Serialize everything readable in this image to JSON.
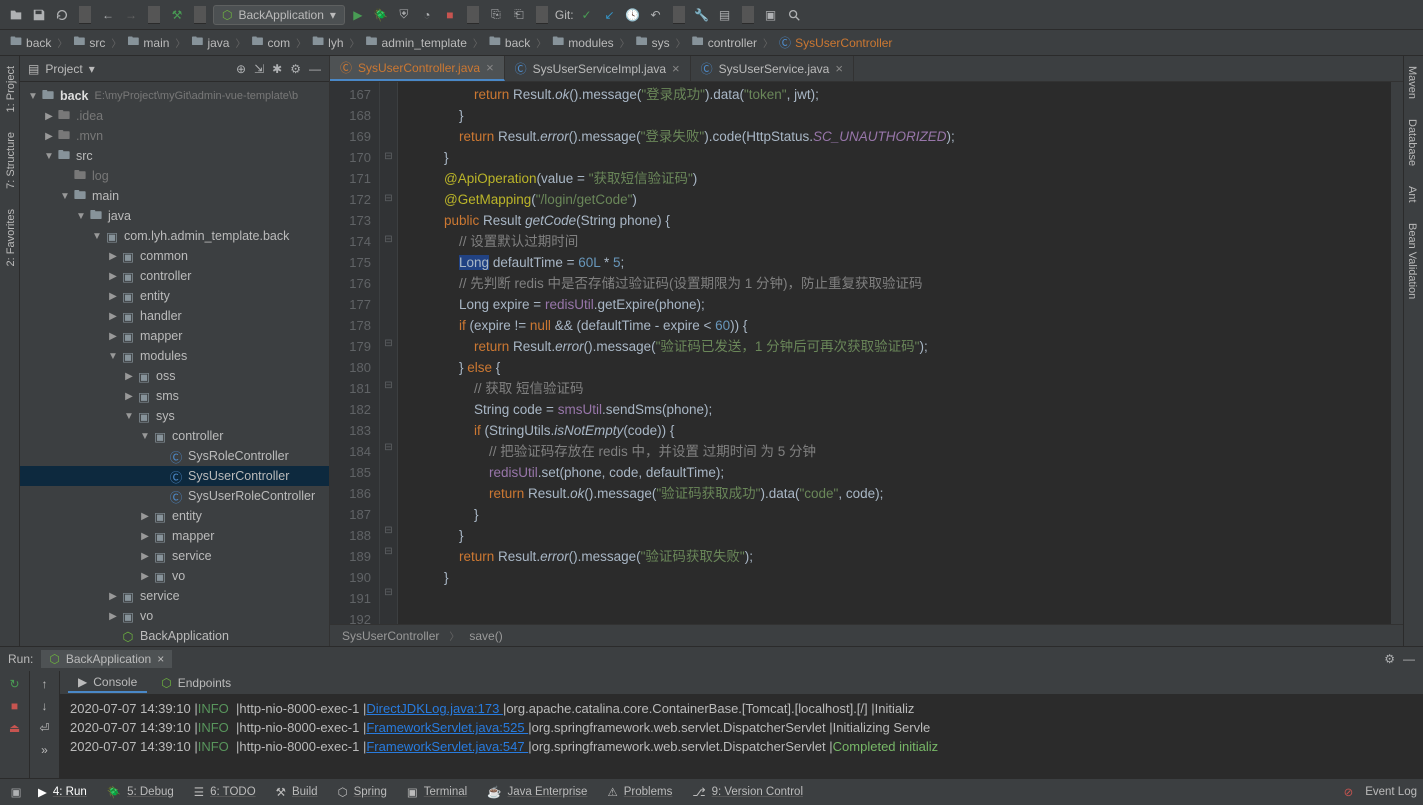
{
  "toolbar": {
    "run_config": "BackApplication",
    "git_label": "Git:"
  },
  "breadcrumbs": [
    "back",
    "src",
    "main",
    "java",
    "com",
    "lyh",
    "admin_template",
    "back",
    "modules",
    "sys",
    "controller",
    "SysUserController"
  ],
  "project": {
    "title": "Project",
    "tree": [
      {
        "depth": 0,
        "arrow": "▼",
        "icon": "folder",
        "label": "back",
        "ext": "E:\\myProject\\myGit\\admin-vue-template\\b",
        "bold": true
      },
      {
        "depth": 1,
        "arrow": "▶",
        "icon": "folder",
        "label": ".idea",
        "dim": true
      },
      {
        "depth": 1,
        "arrow": "▶",
        "icon": "folder",
        "label": ".mvn",
        "dim": true
      },
      {
        "depth": 1,
        "arrow": "▼",
        "icon": "folder",
        "label": "src"
      },
      {
        "depth": 2,
        "arrow": "",
        "icon": "folder",
        "label": "log",
        "dim": true
      },
      {
        "depth": 2,
        "arrow": "▼",
        "icon": "folder",
        "label": "main"
      },
      {
        "depth": 3,
        "arrow": "▼",
        "icon": "folder",
        "label": "java"
      },
      {
        "depth": 4,
        "arrow": "▼",
        "icon": "package",
        "label": "com.lyh.admin_template.back"
      },
      {
        "depth": 5,
        "arrow": "▶",
        "icon": "package",
        "label": "common"
      },
      {
        "depth": 5,
        "arrow": "▶",
        "icon": "package",
        "label": "controller"
      },
      {
        "depth": 5,
        "arrow": "▶",
        "icon": "package",
        "label": "entity"
      },
      {
        "depth": 5,
        "arrow": "▶",
        "icon": "package",
        "label": "handler"
      },
      {
        "depth": 5,
        "arrow": "▶",
        "icon": "package",
        "label": "mapper"
      },
      {
        "depth": 5,
        "arrow": "▼",
        "icon": "package",
        "label": "modules"
      },
      {
        "depth": 6,
        "arrow": "▶",
        "icon": "package",
        "label": "oss"
      },
      {
        "depth": 6,
        "arrow": "▶",
        "icon": "package",
        "label": "sms"
      },
      {
        "depth": 6,
        "arrow": "▼",
        "icon": "package",
        "label": "sys"
      },
      {
        "depth": 7,
        "arrow": "▼",
        "icon": "package",
        "label": "controller"
      },
      {
        "depth": 8,
        "arrow": "",
        "icon": "class",
        "label": "SysRoleController"
      },
      {
        "depth": 8,
        "arrow": "",
        "icon": "class",
        "label": "SysUserController",
        "selected": true
      },
      {
        "depth": 8,
        "arrow": "",
        "icon": "class",
        "label": "SysUserRoleController"
      },
      {
        "depth": 7,
        "arrow": "▶",
        "icon": "package",
        "label": "entity"
      },
      {
        "depth": 7,
        "arrow": "▶",
        "icon": "package",
        "label": "mapper"
      },
      {
        "depth": 7,
        "arrow": "▶",
        "icon": "package",
        "label": "service"
      },
      {
        "depth": 7,
        "arrow": "▶",
        "icon": "package",
        "label": "vo"
      },
      {
        "depth": 5,
        "arrow": "▶",
        "icon": "package",
        "label": "service"
      },
      {
        "depth": 5,
        "arrow": "▶",
        "icon": "package",
        "label": "vo"
      },
      {
        "depth": 5,
        "arrow": "",
        "icon": "class",
        "label": "BackApplication",
        "spring": true
      }
    ]
  },
  "editor": {
    "tabs": [
      {
        "label": "SysUserController.java",
        "active": true,
        "color": "#cc7832"
      },
      {
        "label": "SysUserServiceImpl.java",
        "active": false,
        "color": "#4e8bca"
      },
      {
        "label": "SysUserService.java",
        "active": false,
        "color": "#4e8bca"
      }
    ],
    "line_start": 167,
    "line_end": 192,
    "breadcrumb": [
      "SysUserController",
      "save()"
    ]
  },
  "side_tabs_left": [
    "1: Project",
    "7: Structure",
    "2: Favorites"
  ],
  "side_tabs_right": [
    "Maven",
    "Database",
    "Ant",
    "Bean Validation"
  ],
  "run": {
    "title": "Run:",
    "config": "BackApplication",
    "inner_tabs": [
      "Console",
      "Endpoints"
    ],
    "logs": [
      {
        "ts": "2020-07-07 14:39:10",
        "level": "INFO",
        "thread": "http-nio-8000-exec-1",
        "src": "DirectJDKLog.java:173",
        "logger": "org.apache.catalina.core.ContainerBase.[Tomcat].[localhost].[/]",
        "msg": "Initializ"
      },
      {
        "ts": "2020-07-07 14:39:10",
        "level": "INFO",
        "thread": "http-nio-8000-exec-1",
        "src": "FrameworkServlet.java:525",
        "logger": "org.springframework.web.servlet.DispatcherServlet",
        "msg": "Initializing Servle"
      },
      {
        "ts": "2020-07-07 14:39:10",
        "level": "INFO",
        "thread": "http-nio-8000-exec-1",
        "src": "FrameworkServlet.java:547",
        "logger": "org.springframework.web.servlet.DispatcherServlet",
        "msg": "Completed initializ",
        "completed": true
      }
    ]
  },
  "status": {
    "items": [
      "4: Run",
      "5: Debug",
      "6: TODO",
      "Build",
      "Spring",
      "Terminal",
      "Java Enterprise",
      "Problems",
      "9: Version Control"
    ],
    "event_log": "Event Log"
  },
  "code_lines": [
    {
      "n": 167,
      "html": "                <span class='kw'>return</span> Result.<span class='mth stat'>ok</span>().message(<span class='str'>\"登录成功\"</span>).data(<span class='str'>\"token\"</span>, jwt);"
    },
    {
      "n": 168,
      "html": "            }"
    },
    {
      "n": 169,
      "html": "            <span class='kw'>return</span> Result.<span class='mth stat'>error</span>().message(<span class='str'>\"登录失败\"</span>).code(HttpStatus.<span class='fld stat'>SC_UNAUTHORIZED</span>);"
    },
    {
      "n": 170,
      "html": "        }"
    },
    {
      "n": 171,
      "html": ""
    },
    {
      "n": 172,
      "html": "        <span class='ann'>@ApiOperation</span>(value = <span class='str'>\"获取短信验证码\"</span>)"
    },
    {
      "n": 173,
      "html": "        <span class='ann'>@GetMapping</span>(<span class='str'>\"/login/getCode\"</span>)"
    },
    {
      "n": 174,
      "html": "        <span class='kw'>public</span> Result <span class='mth'>getCode</span>(String phone) {"
    },
    {
      "n": 175,
      "html": "            <span class='com'>// 设置默认过期时间</span>"
    },
    {
      "n": 176,
      "html": "            <span class='hl'>Long</span> defaultTime = <span class='num'>60L</span> * <span class='num'>5</span>;"
    },
    {
      "n": 177,
      "html": "            <span class='com'>// 先判断 redis 中是否存储过验证码(设置期限为 1 分钟)，防止重复获取验证码</span>"
    },
    {
      "n": 178,
      "html": "            Long expire = <span class='fld'>redisUtil</span>.getExpire(phone);"
    },
    {
      "n": 179,
      "html": "            <span class='kw'>if</span> (expire != <span class='kw'>null</span> && (defaultTime - expire &lt; <span class='num'>60</span>)) {"
    },
    {
      "n": 180,
      "html": "                <span class='kw'>return</span> Result.<span class='mth stat'>error</span>().message(<span class='str'>\"验证码已发送，1 分钟后可再次获取验证码\"</span>);"
    },
    {
      "n": 181,
      "html": "            } <span class='kw'>else</span> {"
    },
    {
      "n": 182,
      "html": "                <span class='com'>// 获取 短信验证码</span>"
    },
    {
      "n": 183,
      "html": "                String code = <span class='fld'>smsUtil</span>.sendSms(phone);"
    },
    {
      "n": 184,
      "html": "                <span class='kw'>if</span> (StringUtils.<span class='mth stat'>isNotEmpty</span>(code)) {"
    },
    {
      "n": 185,
      "html": "                    <span class='com'>// 把验证码存放在 redis 中，并设置 过期时间 为 5 分钟</span>"
    },
    {
      "n": 186,
      "html": "                    <span class='fld'>redisUtil</span>.set(phone, code, defaultTime);"
    },
    {
      "n": 187,
      "html": "                    <span class='kw'>return</span> Result.<span class='mth stat'>ok</span>().message(<span class='str'>\"验证码获取成功\"</span>).data(<span class='str'>\"code\"</span>, code);"
    },
    {
      "n": 188,
      "html": "                }"
    },
    {
      "n": 189,
      "html": "            }"
    },
    {
      "n": 190,
      "html": "            <span class='kw'>return</span> Result.<span class='mth stat'>error</span>().message(<span class='str'>\"验证码获取失败\"</span>);"
    },
    {
      "n": 191,
      "html": "        }"
    },
    {
      "n": 192,
      "html": ""
    }
  ]
}
